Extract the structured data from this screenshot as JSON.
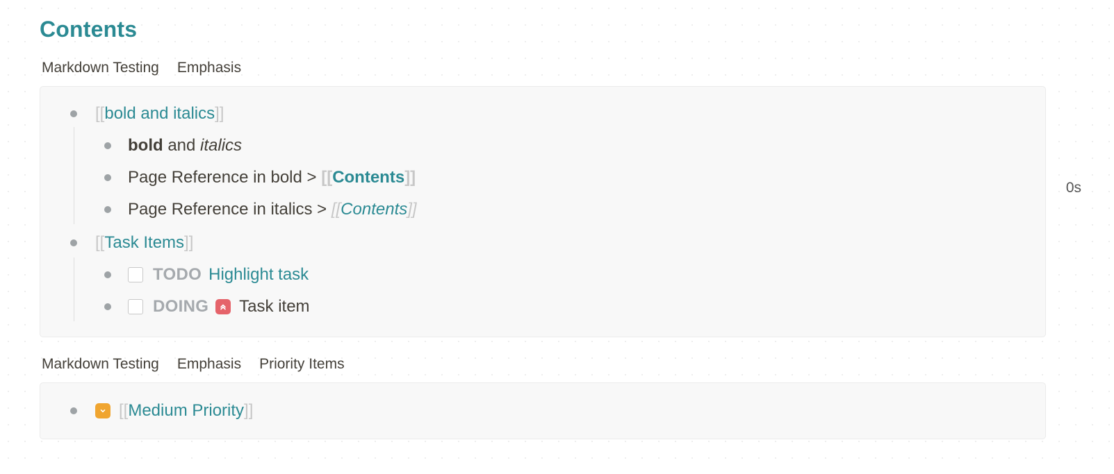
{
  "page": {
    "title": "Contents"
  },
  "section1": {
    "breadcrumb": [
      "Markdown Testing",
      "Emphasis"
    ],
    "items": {
      "bold_italics_ref": "bold and italics",
      "bold_word": "bold",
      "and_word": " and ",
      "italics_word": "italics",
      "ref_bold_prefix": "Page Reference in bold > ",
      "ref_bold_target": "Contents",
      "ref_italic_prefix": "Page Reference in italics > ",
      "ref_italic_target": "Contents",
      "task_items_ref": "Task Items",
      "todo_marker": "TODO",
      "todo_text": "Highlight task",
      "todo_timer": "0s",
      "doing_marker": "DOING",
      "doing_text": "Task item"
    }
  },
  "section2": {
    "breadcrumb": [
      "Markdown Testing",
      "Emphasis",
      "Priority Items"
    ],
    "items": {
      "medium_priority_ref": "Medium Priority"
    }
  },
  "brackets": {
    "open": "[[",
    "close": "]]"
  },
  "colors": {
    "accent": "#2b8a93",
    "high_priority": "#e5636a",
    "medium_priority": "#f0a530"
  },
  "icons": {
    "high_priority": "double-chevron-up-icon",
    "medium_priority": "chevron-down-icon"
  }
}
